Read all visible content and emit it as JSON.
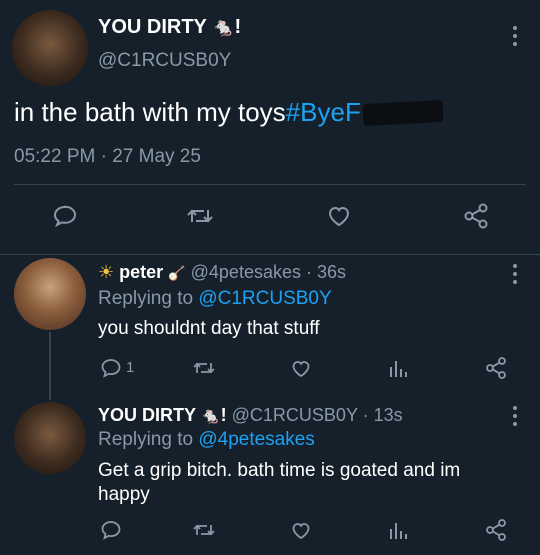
{
  "main_tweet": {
    "display_name": "YOU DIRTY",
    "name_suffix": "!",
    "handle": "@C1RCUSB0Y",
    "text": "in the bath with my toys",
    "hashtag": "#ByeF",
    "time": "05:22 PM",
    "date_sep": "·",
    "date": "27 May 25",
    "icons": [
      "reply-icon",
      "retweet-icon",
      "like-icon",
      "share-icon"
    ]
  },
  "reply1": {
    "display_name": "peter",
    "handle": "@4petesakes",
    "sep": "·",
    "time_ago": "36s",
    "replying_prefix": "Replying to",
    "replying_to": "@C1RCUSB0Y",
    "text": "you shouldnt day that stuff",
    "reply_count": "1",
    "icons": [
      "reply-icon",
      "retweet-icon",
      "like-icon",
      "stats-icon",
      "share-icon"
    ]
  },
  "reply2": {
    "display_name": "YOU DIRTY",
    "name_suffix": "!",
    "handle": "@C1RCUSB0Y",
    "sep": "·",
    "time_ago": "13s",
    "replying_prefix": "Replying to",
    "replying_to": "@4petesakes",
    "text": "Get a grip bitch. bath time is goated and im happy",
    "icons": [
      "reply-icon",
      "retweet-icon",
      "like-icon",
      "stats-icon",
      "share-icon"
    ]
  },
  "colors": {
    "background": "#15202b",
    "text": "#ffffff",
    "muted": "#8899a6",
    "link": "#1da1f2",
    "divider": "#38444d"
  }
}
